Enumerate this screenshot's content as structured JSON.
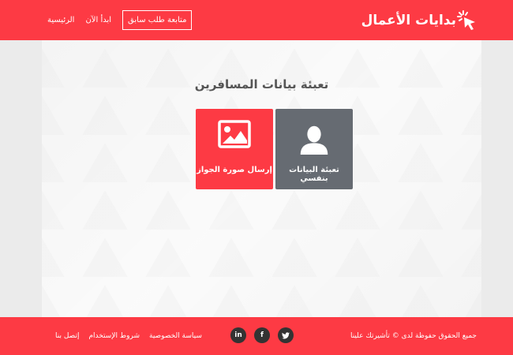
{
  "header": {
    "logo_text": "بدايات الأعمال",
    "nav": {
      "follow_label": "متابعة طلب سابق",
      "start_label": "ابدأ الآن",
      "home_label": "الرئيسية"
    }
  },
  "main": {
    "title": "تعبئة بيانات المسافرين",
    "cards": [
      {
        "label": "تعبئة البيانات بنفسي",
        "icon": "user-icon"
      },
      {
        "label": "إرسال صورة الجواز",
        "icon": "image-icon"
      }
    ]
  },
  "footer": {
    "copyright": "جميع الحقوق حفوظة لدى © تأشيرتك علينا",
    "social": {
      "twitter": "twitter-icon",
      "facebook": "f",
      "linkedin": "in"
    },
    "links": {
      "privacy": "سياسة الخصوصية",
      "terms": "شروط الإستخدام",
      "contact": "إتصل بنا"
    }
  },
  "colors": {
    "brand": "#fd3a44",
    "card_gray": "#666b72",
    "social_bg": "#333333"
  }
}
